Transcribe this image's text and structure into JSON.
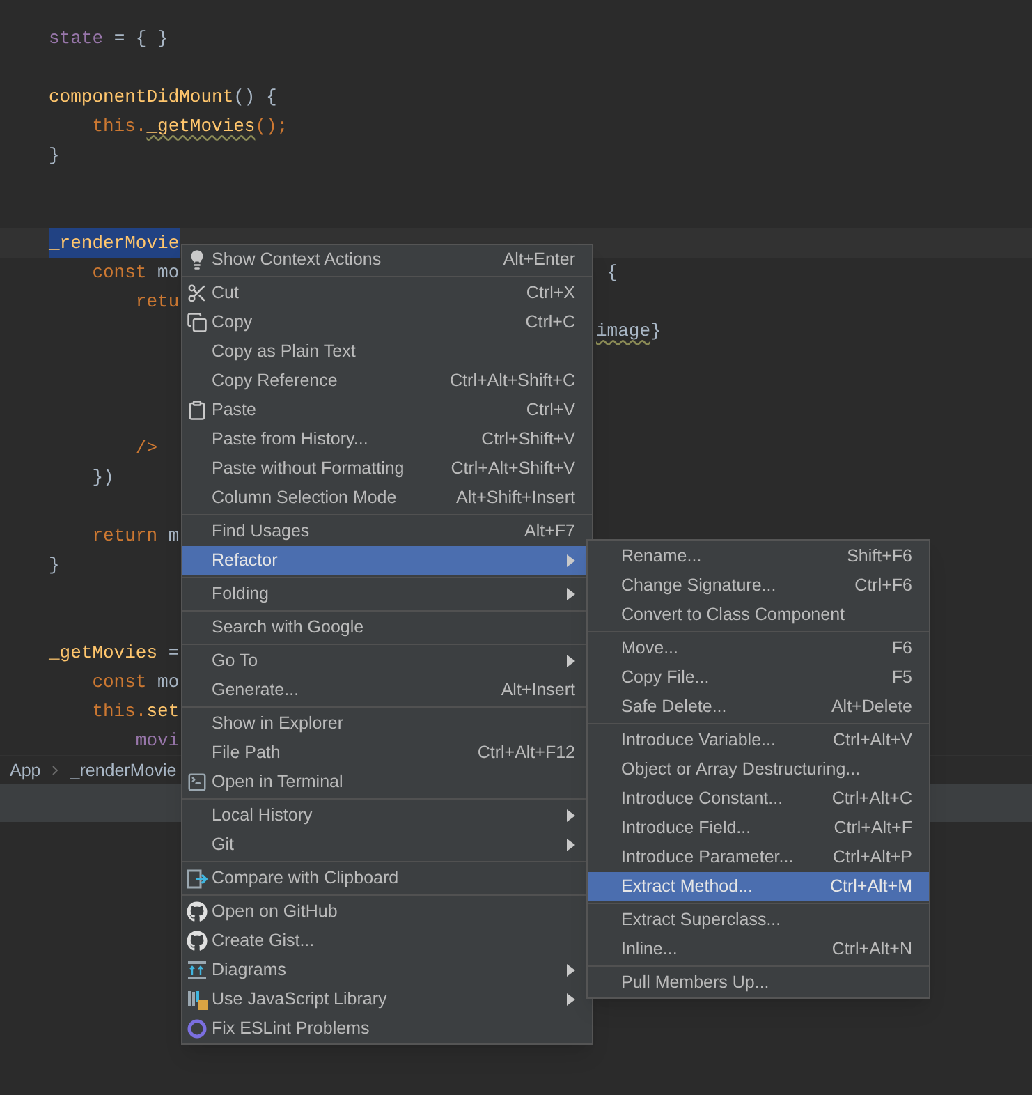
{
  "editor": {
    "lines": [
      {
        "segments": [
          {
            "text": "state",
            "kind": "field"
          },
          {
            "text": " = { }",
            "kind": "plain"
          }
        ]
      },
      {
        "segments": [
          {
            "text": "componentDidMount",
            "kind": "function"
          },
          {
            "text": "() {",
            "kind": "plain"
          }
        ]
      },
      {
        "segments": [
          {
            "text": "    this.",
            "kind": "keyword"
          },
          {
            "text": "_getMovies",
            "kind": "function",
            "warning": true
          },
          {
            "text": "();",
            "kind": "keyword"
          }
        ]
      },
      {
        "segments": [
          {
            "text": "}",
            "kind": "plain"
          }
        ]
      },
      {
        "current": true,
        "segments": [
          {
            "text": "_renderMovie",
            "kind": "function",
            "selected": true
          }
        ]
      },
      {
        "segments": [
          {
            "text": "    const ",
            "kind": "keyword"
          },
          {
            "text": "mo",
            "kind": "plain"
          }
        ],
        "tail": [
          {
            "text": " {",
            "kind": "plain"
          }
        ]
      },
      {
        "segments": [
          {
            "text": "        retu",
            "kind": "keyword"
          }
        ]
      },
      {
        "tail": [
          {
            "text": "image",
            "kind": "plain",
            "warning": true
          },
          {
            "text": "}",
            "kind": "plain"
          }
        ]
      },
      {
        "segments": [
          {
            "text": "        />",
            "kind": "keyword"
          }
        ]
      },
      {
        "segments": [
          {
            "text": "    })",
            "kind": "plain"
          }
        ]
      },
      {
        "segments": [
          {
            "text": "    return ",
            "kind": "keyword"
          },
          {
            "text": "m",
            "kind": "plain"
          }
        ]
      },
      {
        "segments": [
          {
            "text": "}",
            "kind": "plain"
          }
        ]
      },
      {
        "segments": [
          {
            "text": "_getMovies",
            "kind": "function"
          },
          {
            "text": " =",
            "kind": "plain"
          }
        ]
      },
      {
        "segments": [
          {
            "text": "    const ",
            "kind": "keyword"
          },
          {
            "text": "mo",
            "kind": "plain"
          }
        ]
      },
      {
        "segments": [
          {
            "text": "    this.",
            "kind": "keyword"
          },
          {
            "text": "set",
            "kind": "function"
          }
        ]
      },
      {
        "segments": [
          {
            "text": "        movi",
            "kind": "field"
          }
        ]
      }
    ]
  },
  "breadcrumbs": [
    "App",
    "_renderMovie"
  ],
  "context_menu": {
    "groups": [
      [
        {
          "label": "Show Context Actions",
          "shortcut": "Alt+Enter"
        }
      ],
      [
        {
          "label": "Cut",
          "shortcut": "Ctrl+X"
        },
        {
          "label": "Copy",
          "shortcut": "Ctrl+C"
        },
        {
          "label": "Copy as Plain Text"
        },
        {
          "label": "Copy Reference",
          "shortcut": "Ctrl+Alt+Shift+C"
        },
        {
          "label": "Paste",
          "shortcut": "Ctrl+V"
        },
        {
          "label": "Paste from History...",
          "shortcut": "Ctrl+Shift+V"
        },
        {
          "label": "Paste without Formatting",
          "shortcut": "Ctrl+Alt+Shift+V"
        },
        {
          "label": "Column Selection Mode",
          "shortcut": "Alt+Shift+Insert"
        }
      ],
      [
        {
          "label": "Find Usages",
          "shortcut": "Alt+F7",
          "selected": false
        },
        {
          "label": "Refactor",
          "submenu": true,
          "selected": true
        }
      ],
      [
        {
          "label": "Folding",
          "submenu": true
        }
      ],
      [
        {
          "label": "Search with Google"
        }
      ],
      [
        {
          "label": "Go To",
          "submenu": true
        },
        {
          "label": "Generate...",
          "shortcut": "Alt+Insert"
        }
      ],
      [
        {
          "label": "Show in Explorer"
        },
        {
          "label": "File Path",
          "shortcut": "Ctrl+Alt+F12"
        },
        {
          "label": "Open in Terminal"
        }
      ],
      [
        {
          "label": "Local History",
          "submenu": true
        },
        {
          "label": "Git",
          "submenu": true
        }
      ],
      [
        {
          "label": "Compare with Clipboard"
        }
      ],
      [
        {
          "label": "Open on GitHub"
        },
        {
          "label": "Create Gist..."
        },
        {
          "label": "Diagrams",
          "submenu": true
        },
        {
          "label": "Use JavaScript Library",
          "submenu": true
        },
        {
          "label": "Fix ESLint Problems"
        }
      ]
    ]
  },
  "submenu": {
    "groups": [
      [
        {
          "label": "Rename...",
          "shortcut": "Shift+F6"
        },
        {
          "label": "Change Signature...",
          "shortcut": "Ctrl+F6"
        },
        {
          "label": "Convert to Class Component"
        }
      ],
      [
        {
          "label": "Move...",
          "shortcut": "F6"
        },
        {
          "label": "Copy File...",
          "shortcut": "F5"
        },
        {
          "label": "Safe Delete...",
          "shortcut": "Alt+Delete"
        }
      ],
      [
        {
          "label": "Introduce Variable...",
          "shortcut": "Ctrl+Alt+V"
        },
        {
          "label": "Object or Array Destructuring..."
        },
        {
          "label": "Introduce Constant...",
          "shortcut": "Ctrl+Alt+C"
        },
        {
          "label": "Introduce Field...",
          "shortcut": "Ctrl+Alt+F"
        },
        {
          "label": "Introduce Parameter...",
          "shortcut": "Ctrl+Alt+P"
        },
        {
          "label": "Extract Method...",
          "shortcut": "Ctrl+Alt+M",
          "selected": true
        }
      ],
      [
        {
          "label": "Extract Superclass..."
        },
        {
          "label": "Inline...",
          "shortcut": "Ctrl+Alt+N"
        }
      ],
      [
        {
          "label": "Pull Members Up..."
        }
      ]
    ]
  }
}
